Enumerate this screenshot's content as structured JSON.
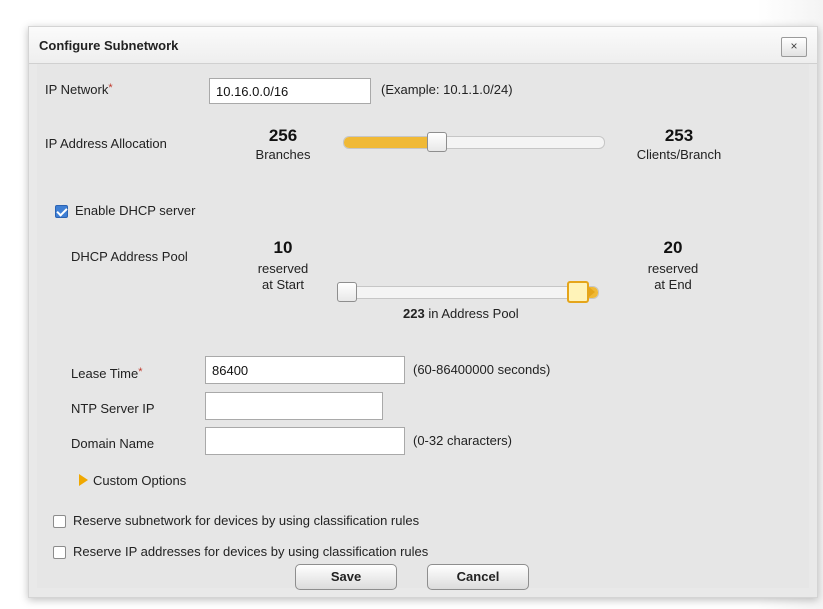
{
  "dialog": {
    "title": "Configure Subnetwork",
    "close_label": "×"
  },
  "ip_network": {
    "label": "IP Network",
    "required_mark": "*",
    "value": "10.16.0.0/16",
    "hint": "(Example: 10.1.1.0/24)"
  },
  "allocation": {
    "label": "IP Address Allocation",
    "left_value": "256",
    "left_caption": "Branches",
    "right_value": "253",
    "right_caption": "Clients/Branch",
    "slider_fraction": 0.36
  },
  "dhcp": {
    "enable_label": "Enable DHCP server",
    "enabled": true,
    "pool_label": "DHCP Address Pool",
    "start_value": "10",
    "start_caption_1": "reserved",
    "start_caption_2": "at Start",
    "end_value": "20",
    "end_caption_1": "reserved",
    "end_caption_2": "at End",
    "pool_count": "223",
    "pool_text": "in Address Pool"
  },
  "lease": {
    "label": "Lease Time",
    "required_mark": "*",
    "value": "86400",
    "hint": "(60-86400000 seconds)"
  },
  "ntp": {
    "label": "NTP Server IP",
    "value": ""
  },
  "domain": {
    "label": "Domain Name",
    "value": "",
    "hint": "(0-32 characters)"
  },
  "custom_options": {
    "label": "Custom Options",
    "icon": "expand-triangle-icon"
  },
  "reserve_subnetwork": {
    "label": "Reserve subnetwork for devices by using classification rules",
    "checked": false
  },
  "reserve_ip": {
    "label": "Reserve IP addresses for devices by using classification rules",
    "checked": false
  },
  "buttons": {
    "save": "Save",
    "cancel": "Cancel"
  },
  "colors": {
    "accent": "#f0b936",
    "required": "#c0392b",
    "checkbox": "#3f7fd4"
  }
}
